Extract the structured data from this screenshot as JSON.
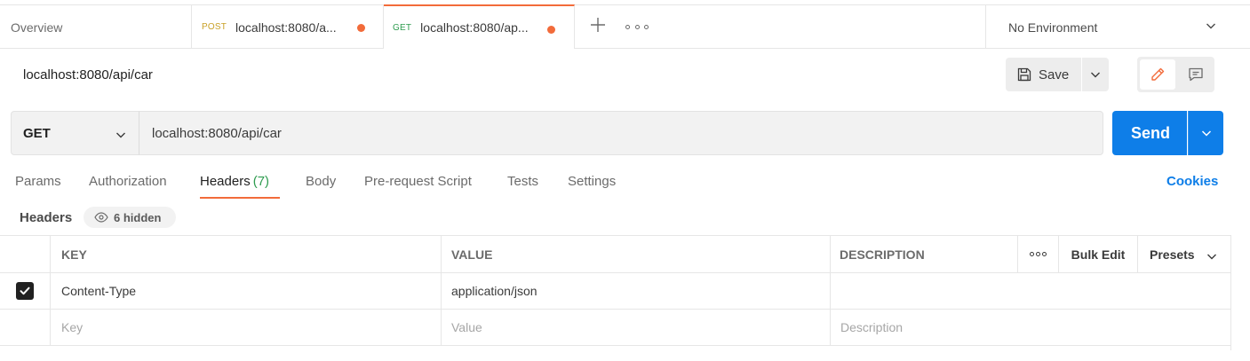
{
  "tabs": {
    "overview_label": "Overview",
    "post_tab": {
      "method": "POST",
      "label": "localhost:8080/a..."
    },
    "get_tab": {
      "method": "GET",
      "label": "localhost:8080/ap..."
    },
    "environment": "No Environment"
  },
  "request": {
    "title": "localhost:8080/api/car",
    "save_label": "Save",
    "method": "GET",
    "url": "localhost:8080/api/car",
    "send_label": "Send"
  },
  "subtabs": {
    "params": "Params",
    "authorization": "Authorization",
    "headers": "Headers",
    "headers_count": "(7)",
    "body": "Body",
    "prerequest": "Pre-request Script",
    "tests": "Tests",
    "settings": "Settings",
    "cookies": "Cookies"
  },
  "headers_section": {
    "label": "Headers",
    "hidden_label": "6 hidden"
  },
  "table": {
    "columns": {
      "key": "KEY",
      "value": "VALUE",
      "description": "DESCRIPTION",
      "bulk_edit": "Bulk Edit",
      "presets": "Presets"
    },
    "rows": [
      {
        "checked": true,
        "key": "Content-Type",
        "value": "application/json",
        "description": ""
      }
    ],
    "new_row": {
      "key_placeholder": "Key",
      "value_placeholder": "Value",
      "description_placeholder": "Description"
    }
  },
  "colors": {
    "accent": "#f26b3a",
    "send_blue": "#0e7ee8",
    "get_green": "#2e9c4f",
    "post_yellow": "#c9a128"
  },
  "icons": [
    "plus-icon",
    "more-icon",
    "chevron-down-icon",
    "save-icon",
    "edit-icon",
    "comment-icon",
    "eye-icon",
    "check-icon"
  ]
}
